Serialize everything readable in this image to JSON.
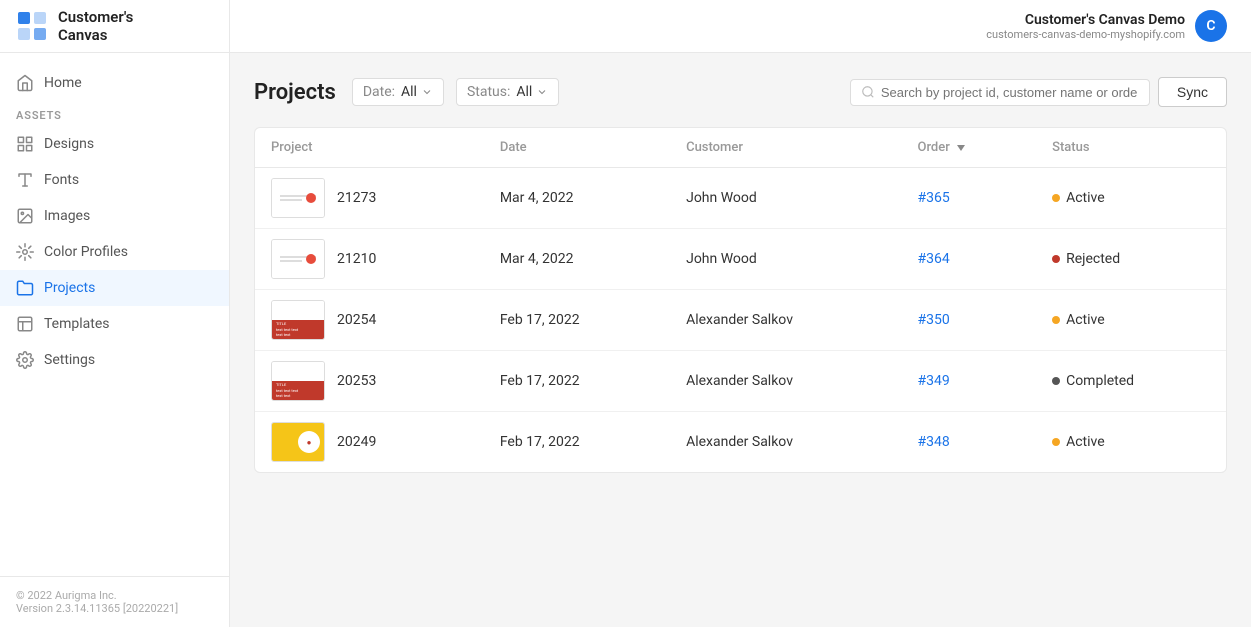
{
  "app": {
    "logo_text": "Customer's\nCanvas",
    "version": "© 2022 Aurigma Inc.\nVersion 2.3.14.11365 [20220221]"
  },
  "user": {
    "name": "Customer's Canvas Demo",
    "sub": "customers-canvas-demo-myshopify.com",
    "avatar_initial": "C"
  },
  "sidebar": {
    "home_label": "Home",
    "assets_label": "ASSETS",
    "designs_label": "Designs",
    "fonts_label": "Fonts",
    "images_label": "Images",
    "color_profiles_label": "Color Profiles",
    "projects_label": "Projects",
    "templates_label": "Templates",
    "settings_label": "Settings"
  },
  "page": {
    "title": "Projects",
    "date_filter_label": "Date:",
    "date_filter_value": "All",
    "status_filter_label": "Status:",
    "status_filter_value": "All",
    "search_placeholder": "Search by project id, customer name or orde…",
    "sync_label": "Sync"
  },
  "table": {
    "columns": [
      "Project",
      "Date",
      "Customer",
      "Order",
      "Status"
    ],
    "rows": [
      {
        "id": "21273",
        "date": "Mar 4, 2022",
        "customer": "John Wood",
        "order": "#365",
        "status": "Active",
        "status_type": "active"
      },
      {
        "id": "21210",
        "date": "Mar 4, 2022",
        "customer": "John Wood",
        "order": "#364",
        "status": "Rejected",
        "status_type": "rejected"
      },
      {
        "id": "20254",
        "date": "Feb 17, 2022",
        "customer": "Alexander Salkov",
        "order": "#350",
        "status": "Active",
        "status_type": "active"
      },
      {
        "id": "20253",
        "date": "Feb 17, 2022",
        "customer": "Alexander Salkov",
        "order": "#349",
        "status": "Completed",
        "status_type": "completed"
      },
      {
        "id": "20249",
        "date": "Feb 17, 2022",
        "customer": "Alexander Salkov",
        "order": "#348",
        "status": "Active",
        "status_type": "active"
      }
    ]
  }
}
